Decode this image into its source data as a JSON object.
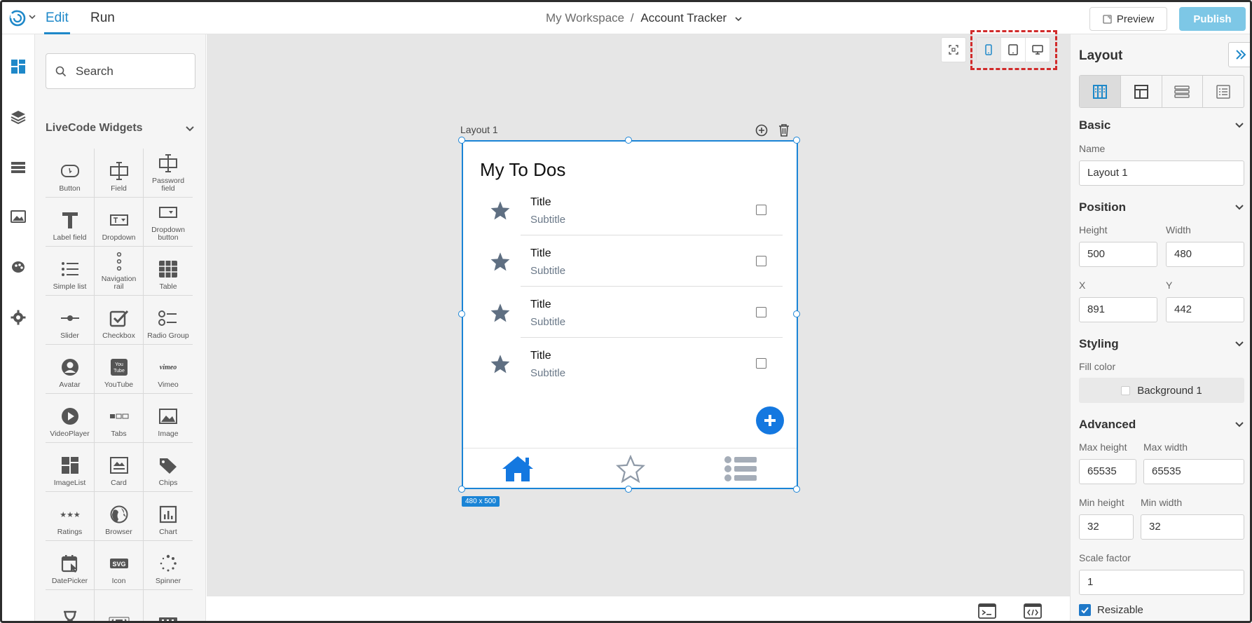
{
  "header": {
    "tab_edit": "Edit",
    "tab_run": "Run",
    "workspace": "My Workspace",
    "separator": "/",
    "project": "Account Tracker",
    "preview_label": "Preview",
    "publish_label": "Publish"
  },
  "rail": {
    "items": [
      "widgets-icon",
      "layers-icon",
      "list-icon",
      "media-icon",
      "theme-icon",
      "settings-icon"
    ]
  },
  "widgets": {
    "search_placeholder": "Search",
    "section_title": "LiveCode Widgets",
    "items": [
      {
        "label": "Button"
      },
      {
        "label": "Field"
      },
      {
        "label": "Password field"
      },
      {
        "label": "Label field"
      },
      {
        "label": "Dropdown"
      },
      {
        "label": "Dropdown button"
      },
      {
        "label": "Simple list"
      },
      {
        "label": "Navigation rail"
      },
      {
        "label": "Table"
      },
      {
        "label": "Slider"
      },
      {
        "label": "Checkbox"
      },
      {
        "label": "Radio Group"
      },
      {
        "label": "Avatar"
      },
      {
        "label": "YouTube"
      },
      {
        "label": "Vimeo"
      },
      {
        "label": "VideoPlayer"
      },
      {
        "label": "Tabs"
      },
      {
        "label": "Image"
      },
      {
        "label": "ImageList"
      },
      {
        "label": "Card"
      },
      {
        "label": "Chips"
      },
      {
        "label": "Ratings"
      },
      {
        "label": "Browser"
      },
      {
        "label": "Chart"
      },
      {
        "label": "DatePicker"
      },
      {
        "label": "Icon"
      },
      {
        "label": "Spinner"
      },
      {
        "label": ""
      },
      {
        "label": ""
      },
      {
        "label": ""
      }
    ]
  },
  "canvas": {
    "layout_label": "Layout 1",
    "size_badge": "480 x 500",
    "screen": {
      "title": "My To Dos",
      "rows": [
        {
          "title": "Title",
          "subtitle": "Subtitle"
        },
        {
          "title": "Title",
          "subtitle": "Subtitle"
        },
        {
          "title": "Title",
          "subtitle": "Subtitle"
        },
        {
          "title": "Title",
          "subtitle": "Subtitle"
        }
      ]
    }
  },
  "properties": {
    "title": "Layout",
    "basic": {
      "heading": "Basic",
      "name_label": "Name",
      "name_value": "Layout 1"
    },
    "position": {
      "heading": "Position",
      "height_label": "Height",
      "height_value": "500",
      "width_label": "Width",
      "width_value": "480",
      "x_label": "X",
      "x_value": "891",
      "y_label": "Y",
      "y_value": "442"
    },
    "styling": {
      "heading": "Styling",
      "fill_label": "Fill color",
      "fill_value": "Background 1"
    },
    "advanced": {
      "heading": "Advanced",
      "max_height_label": "Max height",
      "max_height_value": "65535",
      "max_width_label": "Max width",
      "max_width_value": "65535",
      "min_height_label": "Min height",
      "min_height_value": "32",
      "min_width_label": "Min width",
      "min_width_value": "32",
      "scale_label": "Scale factor",
      "scale_value": "1",
      "resizable_label": "Resizable"
    }
  },
  "colors": {
    "accent": "#1e88c9",
    "selection": "#1a84d6",
    "publish": "#7dc7e6",
    "highlight_dash": "#d12b2b"
  }
}
